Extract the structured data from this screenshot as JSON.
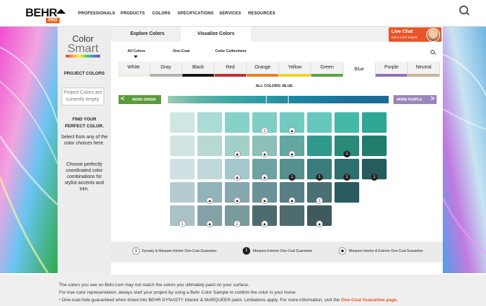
{
  "brand": {
    "name": "BEHR",
    "pro": "PRO"
  },
  "topnav": [
    "PROFESSIONALS",
    "PRODUCTS",
    "COLORS",
    "SPECIFICATIONS",
    "SERVICES",
    "RESOURCES"
  ],
  "colorsmart": {
    "line1": "Color",
    "line2": "Smart"
  },
  "left": {
    "project_heading": "PROJECT COLORS",
    "project_empty": "Project Colors are currently empty.",
    "find_heading": "FIND YOUR PERFECT COLOR.",
    "find_text": "Select from any of the color choices here.",
    "choose_text": "Choose perfectly coordinated color combinations for stylist accents and trim."
  },
  "tabs": [
    "Explore Colors",
    "Visualize Colors"
  ],
  "livechat": {
    "title": "Live Chat",
    "subtitle": "Ask a Color Expert"
  },
  "subnav": [
    "All Colors",
    "One-Coat",
    "Color Collections"
  ],
  "families": [
    {
      "name": "White",
      "color": "#efece0"
    },
    {
      "name": "Gray",
      "color": "#b0b0ad"
    },
    {
      "name": "Black",
      "color": "#111111"
    },
    {
      "name": "Red",
      "color": "#c12a2e"
    },
    {
      "name": "Orange",
      "color": "#ef7d1a"
    },
    {
      "name": "Yellow",
      "color": "#f4d21c"
    },
    {
      "name": "Green",
      "color": "#57a33a"
    },
    {
      "name": "Blue",
      "color": ""
    },
    {
      "name": "Purple",
      "color": "#8a6db5"
    },
    {
      "name": "Neutral",
      "color": "#c9b09a"
    }
  ],
  "active_family": "Blue",
  "all_colors_label": "ALL COLORS: BLUE",
  "more_green": "MORE GREEN",
  "more_purple": "MORE PURPLE",
  "legend": [
    {
      "icon": "1",
      "text": "Dynasty & Marquee Interior One-Coat Guarantee"
    },
    {
      "icon": "1",
      "text": "Marquee Exterior One-Coat Guarantee"
    },
    {
      "icon": "◆",
      "text": "Marquee Interior & Exterior One-Coat Guarantee"
    }
  ],
  "footer": {
    "line1": "The colors you see on Behr.com may not match the colors you ultimately paint on your surface.",
    "line2": "For true color representation, always start your project by using a Behr Color Sample to confirm the color in your home.",
    "line3": "¹ One-coat hide guaranteed when tinted into BEHR DYNASTY Interior & MARQUEE® paint. Limitations apply. For more information, visit the",
    "link": "One-Coat Guarantee page."
  },
  "swatches": [
    [
      {
        "c": "#cfe7e2",
        "b": ""
      },
      {
        "c": "#a9dcd5",
        "b": ""
      },
      {
        "c": "#86d2c9",
        "b": ""
      },
      {
        "c": "#80cfc6",
        "b": "dyn"
      },
      {
        "c": "#72c9bf",
        "b": "both"
      },
      {
        "c": "#66c7bc",
        "b": ""
      },
      {
        "c": "#43b9a8",
        "b": ""
      },
      {
        "c": "#2ea894",
        "b": ""
      }
    ],
    [
      {
        "c": "#d2e4e2",
        "b": ""
      },
      {
        "c": "#b8d8d4",
        "b": ""
      },
      {
        "c": "#a3cfc9",
        "b": "both"
      },
      {
        "c": "#8cc0b8",
        "b": "both"
      },
      {
        "c": "#62a7a0",
        "b": "both"
      },
      {
        "c": "#2f9a8b",
        "b": ""
      },
      {
        "c": "#2a8a79",
        "b": "ext"
      },
      {
        "c": "#237d6d",
        "b": ""
      }
    ],
    [
      {
        "c": "#cfe1e2",
        "b": ""
      },
      {
        "c": "#c1d8db",
        "b": ""
      },
      {
        "c": "#a4c7cb",
        "b": "both"
      },
      {
        "c": "#6ea2a4",
        "b": "both"
      },
      {
        "c": "#55908f",
        "b": "ext"
      },
      {
        "c": "#3b7c7c",
        "b": "ext"
      },
      {
        "c": "#2d6e6e",
        "b": "ext"
      },
      {
        "c": "#255d5e",
        "b": "ext"
      }
    ],
    [
      {
        "c": "#b6cbd0",
        "b": ""
      },
      {
        "c": "#93b3ba",
        "b": "both"
      },
      {
        "c": "#86a7ad",
        "b": "both"
      },
      {
        "c": "#6a9299",
        "b": "both"
      },
      {
        "c": "#577f85",
        "b": "both"
      },
      {
        "c": "#4a6f74",
        "b": "dyn"
      },
      {
        "c": "#2a5b60",
        "b": ""
      }
    ],
    [
      {
        "c": "#a9c2c6",
        "b": "dyn"
      },
      {
        "c": "#82a2a5",
        "b": "both"
      },
      {
        "c": "#7a9a9c",
        "b": "dyn"
      },
      {
        "c": "#4d6c6f",
        "b": "both"
      },
      {
        "c": "#4e6c6e",
        "b": ""
      },
      {
        "c": "#3f5a5d",
        "b": "both"
      }
    ]
  ]
}
